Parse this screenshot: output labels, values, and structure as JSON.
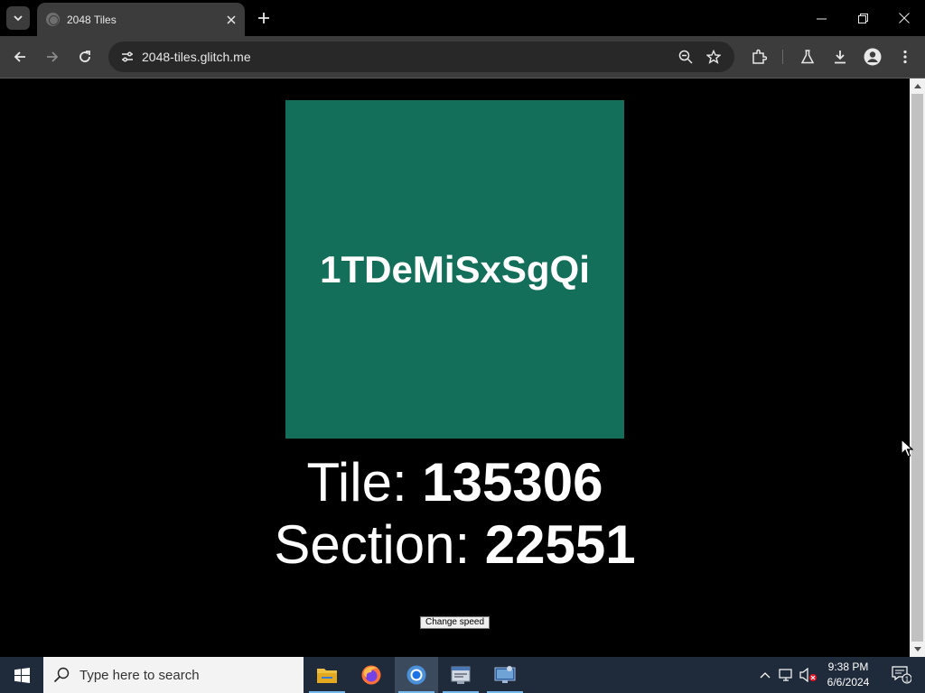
{
  "browser": {
    "tab": {
      "title": "2048 Tiles"
    },
    "address_bar": {
      "url": "2048-tiles.glitch.me"
    }
  },
  "page": {
    "tile_label": "1TDeMiSxSgQi",
    "tile_color": "#136f5a",
    "tile_stat": {
      "label": "Tile: ",
      "value": "135306"
    },
    "section_stat": {
      "label": "Section: ",
      "value": "22551"
    },
    "speed_button_label": "Change speed"
  },
  "taskbar": {
    "search_placeholder": "Type here to search",
    "apps": [
      "file-explorer",
      "firefox",
      "chrome",
      "notepad-window",
      "remote-desktop"
    ],
    "clock_time": "9:38 PM",
    "clock_date": "6/6/2024",
    "notification_count": "1"
  },
  "colors": {
    "taskbar_bg": "#1f2b3a",
    "browser_toolbar": "#3c3c3c",
    "page_bg": "#000000"
  }
}
